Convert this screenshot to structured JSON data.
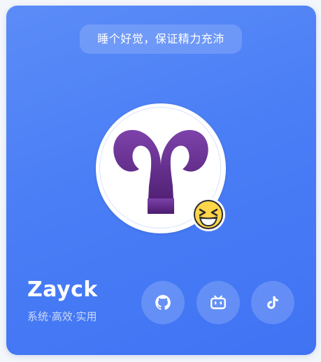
{
  "card": {
    "tip": "睡个好觉，保证精力充沛",
    "name": "Zayck",
    "slogan": "系统·高效·实用"
  },
  "avatar": {
    "icon": "aries-symbol-icon"
  },
  "status_emoji": {
    "icon": "grinning-squinting-face-icon"
  },
  "social": [
    {
      "icon": "github-icon"
    },
    {
      "icon": "bilibili-icon"
    },
    {
      "icon": "tiktok-icon"
    }
  ],
  "colors": {
    "card_gradient_start": "#5b8cf7",
    "card_gradient_end": "#3f73f3",
    "aries_purple_top": "#7b3fa8",
    "aries_purple_bottom": "#4b1c6e",
    "emoji_yellow": "#ffd54a"
  }
}
